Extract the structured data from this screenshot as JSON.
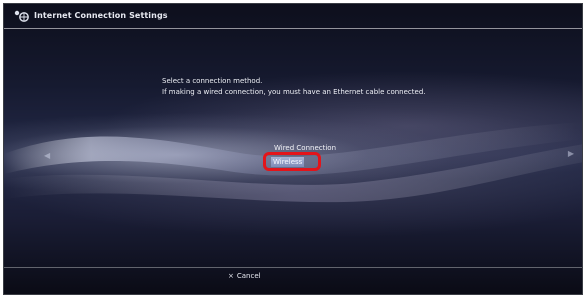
{
  "header": {
    "title": "Internet Connection Settings",
    "icon": "network-settings-icon"
  },
  "instructions": {
    "line1": "Select a connection method.",
    "line2": "If making a wired connection, you must have an Ethernet cable connected."
  },
  "options": {
    "items": [
      {
        "label": "Wired Connection",
        "selected": false
      },
      {
        "label": "Wireless",
        "selected": true
      }
    ]
  },
  "footer": {
    "cancel_icon": "×",
    "cancel_label": "Cancel"
  },
  "colors": {
    "highlight_ring": "#e3141a",
    "selection": "#8f9cc6"
  }
}
